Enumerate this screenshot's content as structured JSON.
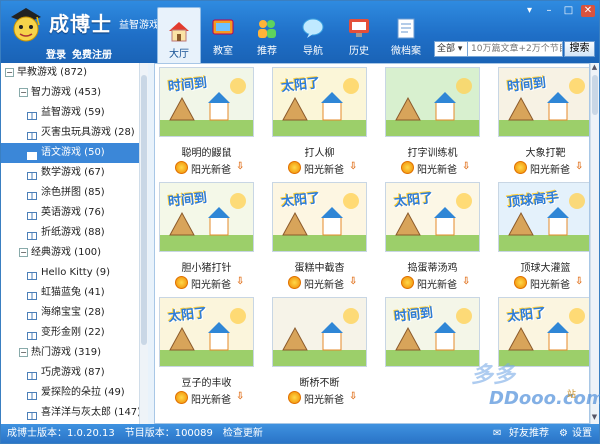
{
  "app": {
    "title": "成博士",
    "subtitle": "益智游戏",
    "login": "登录",
    "register": "免费注册"
  },
  "nav": [
    {
      "label": "大厅",
      "icon": "house-icon",
      "active": true
    },
    {
      "label": "教室",
      "icon": "classroom-icon",
      "active": false
    },
    {
      "label": "推荐",
      "icon": "people-icon",
      "active": false
    },
    {
      "label": "导航",
      "icon": "chat-bubble-icon",
      "active": false
    },
    {
      "label": "历史",
      "icon": "monitor-icon",
      "active": false
    },
    {
      "label": "微档案",
      "icon": "file-icon",
      "active": false
    }
  ],
  "search": {
    "scope": "全部",
    "placeholder": "10万篇文章+2万个节目",
    "button": "搜索"
  },
  "sidebar": {
    "items": [
      {
        "label": "早教游戏 (872)",
        "level": 0,
        "toggle": "−"
      },
      {
        "label": "智力游戏 (453)",
        "level": 1,
        "toggle": "−"
      },
      {
        "label": "益智游戏 (59)",
        "level": 2
      },
      {
        "label": "灭害虫玩具游戏 (28)",
        "level": 2
      },
      {
        "label": "语文游戏 (50)",
        "level": 2,
        "selected": true
      },
      {
        "label": "数学游戏 (67)",
        "level": 2
      },
      {
        "label": "涂色拼图 (85)",
        "level": 2
      },
      {
        "label": "英语游戏 (76)",
        "level": 2
      },
      {
        "label": "折纸游戏 (88)",
        "level": 2
      },
      {
        "label": "经典游戏 (100)",
        "level": 1,
        "toggle": "−"
      },
      {
        "label": "Hello Kitty (9)",
        "level": 2
      },
      {
        "label": "虹猫蓝兔 (41)",
        "level": 2
      },
      {
        "label": "海绵宝宝 (28)",
        "level": 2
      },
      {
        "label": "变形金刚 (22)",
        "level": 2
      },
      {
        "label": "热门游戏 (319)",
        "level": 1,
        "toggle": "−"
      },
      {
        "label": "巧虎游戏 (87)",
        "level": 2
      },
      {
        "label": "爱探险的朵拉 (49)",
        "level": 2
      },
      {
        "label": "喜洋洋与灰太郎 (147)",
        "level": 2
      }
    ]
  },
  "cards": [
    {
      "name": "聪明的鼹鼠",
      "author": "阳光新爸",
      "thumb_text": "时间到",
      "bg": "#f1f6e8"
    },
    {
      "name": "打人柳",
      "author": "阳光新爸",
      "thumb_text": "太阳了",
      "bg": "#fbf6d8"
    },
    {
      "name": "打字训练机",
      "author": "阳光新爸",
      "thumb_text": "",
      "bg": "#d8f0cf"
    },
    {
      "name": "大象打靶",
      "author": "阳光新爸",
      "thumb_text": "时间到",
      "bg": "#f7f2e4"
    },
    {
      "name": "胆小猪打针",
      "author": "阳光新爸",
      "thumb_text": "时间到",
      "bg": "#f4f8e8"
    },
    {
      "name": "蛋糕中截杳",
      "author": "阳光新爸",
      "thumb_text": "太阳了",
      "bg": "#fdf6e2"
    },
    {
      "name": "捣蛋蒂汤鸡",
      "author": "阳光新爸",
      "thumb_text": "太阳了",
      "bg": "#fcf7e6"
    },
    {
      "name": "顶球大灌篮",
      "author": "阳光新爸",
      "thumb_text": "顶球高手",
      "bg": "#e4f1fb"
    },
    {
      "name": "豆子的丰收",
      "author": "阳光新爸",
      "thumb_text": "太阳了",
      "bg": "#fbf5dc"
    },
    {
      "name": "断桥不断",
      "author": "阳光新爸",
      "thumb_text": "",
      "bg": "#f6f3e8"
    },
    {
      "name": "",
      "author": "",
      "thumb_text": "时间到",
      "bg": "#f4f6e8"
    },
    {
      "name": "",
      "author": "",
      "thumb_text": "太阳了",
      "bg": "#fbf5e0"
    }
  ],
  "watermark": {
    "line1": "多多",
    "line2": "DDooo.com",
    "site": "站"
  },
  "status": {
    "left": "成博士版本：1.0.20.13　节目版本：100089　检查更新",
    "friend": "好友推荐",
    "settings": "设置"
  },
  "colors": {
    "accent": "#1f6fc7",
    "selected": "#3b87d8"
  }
}
